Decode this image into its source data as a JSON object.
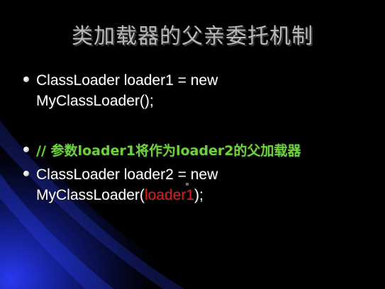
{
  "slide": {
    "title": "类加载器的父亲委托机制",
    "bullets": [
      {
        "line1": "ClassLoader loader1 = new",
        "line2": "MyClassLoader();"
      },
      {
        "comment": "// 参数loader1将作为loader2的父加载器"
      },
      {
        "line1": "ClassLoader loader2 = new",
        "line2_prefix": "MyClassLoader(",
        "line2_arg": "loader1",
        "line2_suffix": ");"
      }
    ]
  },
  "colors": {
    "background": "#000000",
    "title": "#b8b8b8",
    "body_text": "#ffffff",
    "comment": "#6cd23a",
    "highlight_arg": "#e01818",
    "swoosh": "#1a2aa8"
  }
}
